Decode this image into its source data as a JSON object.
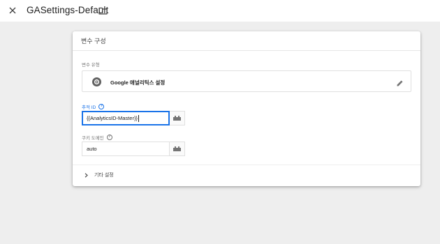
{
  "header": {
    "title": "GASettings-Default"
  },
  "card": {
    "title": "변수 구성",
    "variable_type_label": "변수 유형",
    "variable_type_value": "Google 애널리틱스 설정",
    "tracking_id": {
      "label": "추적 ID",
      "help": "?",
      "value": "{{AnalyticsID-Master}}"
    },
    "cookie_domain": {
      "label": "쿠키 도메인",
      "help": "?",
      "value": "auto"
    },
    "more_settings": {
      "label": "기타 설정"
    }
  },
  "colors": {
    "accent": "#1a73e8",
    "page_bg": "#eeeeee",
    "card_bg": "#ffffff"
  },
  "icons": [
    "close-icon",
    "folder-icon",
    "gear-icon",
    "pencil-icon",
    "help-icon",
    "variable-picker-icon",
    "chevron-right-icon"
  ]
}
